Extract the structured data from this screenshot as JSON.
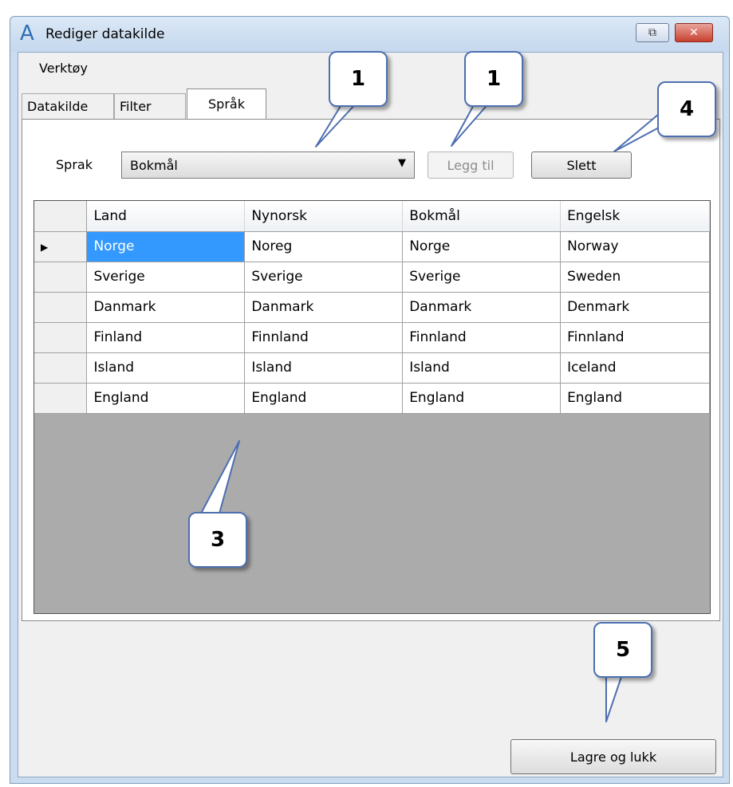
{
  "window": {
    "title": "Rediger datakilde",
    "icon": "app-logo-icon"
  },
  "menu": {
    "tools": "Verktøy"
  },
  "tabs": [
    {
      "label": "Datakilde",
      "active": false
    },
    {
      "label": "Filter",
      "active": false
    },
    {
      "label": "Språk",
      "active": true
    }
  ],
  "language_row": {
    "label": "Sprak",
    "selected": "Bokmål",
    "add_button": "Legg til",
    "delete_button": "Slett"
  },
  "grid": {
    "columns": [
      "Land",
      "Nynorsk",
      "Bokmål",
      "Engelsk"
    ],
    "rows": [
      [
        "Norge",
        "Noreg",
        "Norge",
        "Norway"
      ],
      [
        "Sverige",
        "Sverige",
        "Sverige",
        "Sweden"
      ],
      [
        "Danmark",
        "Danmark",
        "Danmark",
        "Denmark"
      ],
      [
        "Finland",
        "Finnland",
        "Finnland",
        "Finnland"
      ],
      [
        "Island",
        "Island",
        "Island",
        "Iceland"
      ],
      [
        "England",
        "England",
        "England",
        "England"
      ]
    ],
    "current_row_marker": "▶"
  },
  "footer": {
    "save_close": "Lagre og lukk"
  },
  "callouts": [
    "1",
    "1",
    "3",
    "4",
    "5"
  ],
  "colors": {
    "selection": "#3399ff",
    "grid_background": "#ababab",
    "callout_border": "#4d6fb0"
  }
}
